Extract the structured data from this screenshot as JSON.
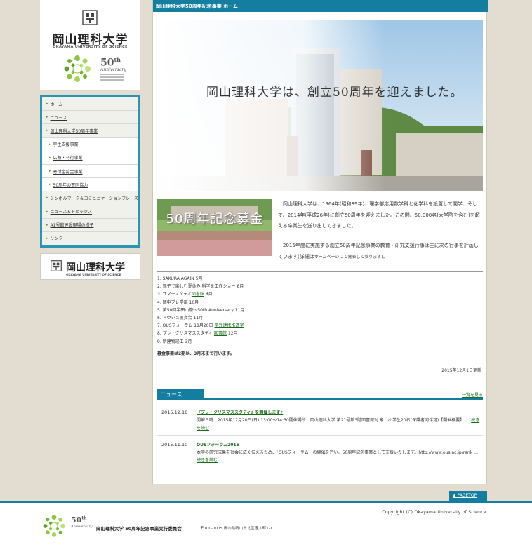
{
  "header": {
    "breadcrumb": "岡山理科大学50周年記念事業 ホーム"
  },
  "logo": {
    "name_jp": "岡山理科大学",
    "name_en": "OKAYAMA UNIVERSITY OF SCIENCE",
    "anniv_num": "50",
    "anniv_suffix": "th",
    "anniv_word": "Anniversary"
  },
  "nav": {
    "items": [
      {
        "label": "ホーム",
        "sub": false
      },
      {
        "label": "ニュース",
        "sub": false
      },
      {
        "label": "岡山理科大学50周年事業",
        "sub": false
      },
      {
        "label": "学生支援事業",
        "sub": true
      },
      {
        "label": "広報・刊行事業",
        "sub": true
      },
      {
        "label": "寄付金募金事業",
        "sub": true
      },
      {
        "label": "50周年の賛同協力",
        "sub": true
      },
      {
        "label": "シンボルマーク＆コミュニケーションフレーズ",
        "sub": false
      },
      {
        "label": "ニュース＆トピックス",
        "sub": false
      },
      {
        "label": "A1号館建設現場の様子",
        "sub": false
      },
      {
        "label": "リンク",
        "sub": false
      }
    ]
  },
  "banner": {
    "name_jp": "岡山理科大学",
    "name_en": "OKAYAMA UNIVERSITY OF SCIENCE"
  },
  "hero": {
    "title": "岡山理科大学は、創立50周年を迎えました。"
  },
  "fund": {
    "title": "50周年記念募金"
  },
  "intro": {
    "p1": "岡山理科大学は、1964年(昭和39年)、理学部応用数学科と化学科を設置して開学、そして、2014年(平成26年)に創立50周年を迎えました。この間、50,000名(大学院を含む)を超える卒業生を送り出してきました。",
    "p2_main": "2015年度に実施する創立50周年記念事業の教育・研究支援行事は主に次の行事を計画しています(詳細は",
    "p2_small": "ホームページにて発表して参ります)。"
  },
  "events": [
    {
      "text": "1. SAKURA AGAIN 5月",
      "link": ""
    },
    {
      "text": "2. 親子で楽しむ夏休み 科学＆工作ショー 8月",
      "link": ""
    },
    {
      "text": "3. サマースタディ",
      "link": "図書館",
      "after": " 8月"
    },
    {
      "text": "4. 岡中ブレ学部 10月",
      "link": ""
    },
    {
      "text": "5. 第50回半田山祭～50th Anniversary 11月",
      "link": ""
    },
    {
      "text": "6. ドウショ展賞会 11月",
      "link": ""
    },
    {
      "text": "7. OUSフォーラム 11月20日 ",
      "link": "学外連携推進室"
    },
    {
      "text": "8. プレ・クリスマススタディ ",
      "link": "図書館",
      "after": " 12月"
    },
    {
      "text": "9. 新建物竣工 3月",
      "link": ""
    }
  ],
  "events_note": "募金事業は2期以、3月末まで行います。",
  "updated": "2015年12月1日更新",
  "news": {
    "heading": "ニュース",
    "more": "一覧を見る",
    "entries": [
      {
        "date": "2015.12.18",
        "title": "『プレ・クリスマススタディ』を開催します♪",
        "body": "開催日時：2015年12月20日(日) 13:00～14:30開催場所：岡山理科大学 第21号館3階図書館対 象：小学生20名(保護者同伴可)【開催概要】",
        "link": "続きを読む"
      },
      {
        "date": "2015.11.10",
        "title": "OUSフォーラム2015",
        "body": "本学の研究成果を社会に広く伝えるため、「OUSフォーラム」の開催を行い、50周年記念事業として支援いたします。http://www.ous.ac.jp/rank …",
        "link": "続きを読む"
      }
    ]
  },
  "pagetop": "▲ PAGETOP",
  "footer": {
    "copyright": "Copyright (C) Okayama University of Science.",
    "anniv_num": "50",
    "anniv_suffix": "th",
    "anniv_word": "Anniversary",
    "org": "岡山理科大学 50周年記念事業実行委員会",
    "address": "〒700-0005 岡山県岡山市北区理大町1-1"
  },
  "colors": {
    "accent": "#137e9f",
    "link_green": "#1a6b1a",
    "page_bg": "#e2ddd0"
  }
}
